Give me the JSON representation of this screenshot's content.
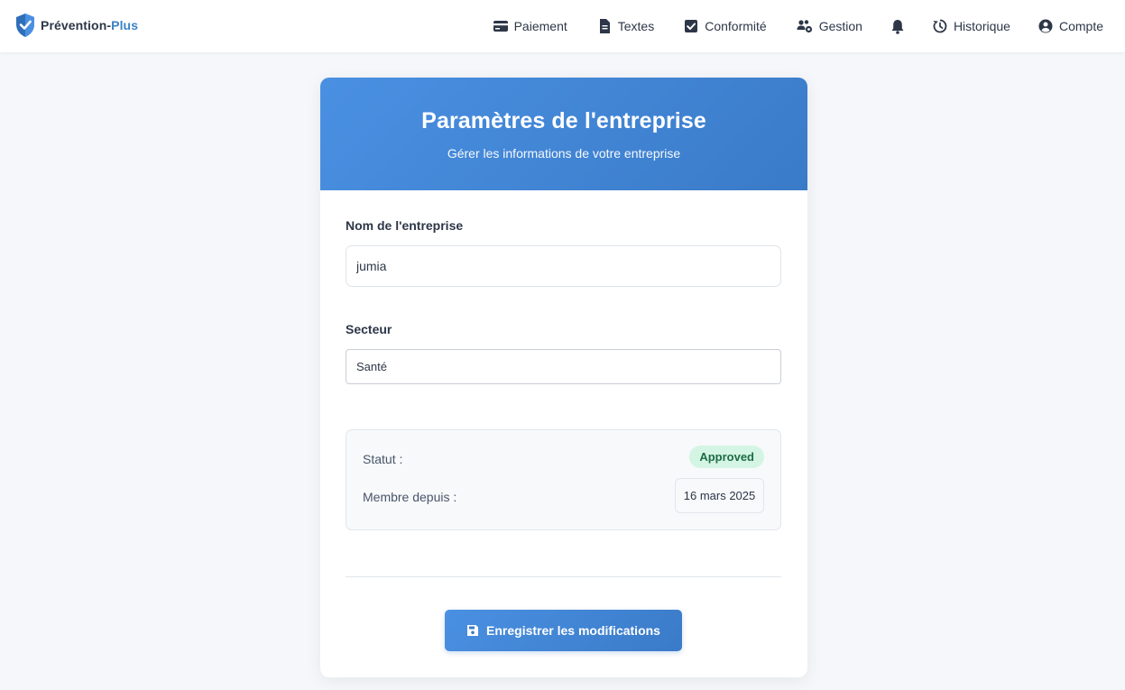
{
  "brand": {
    "name_main": "Prévention-",
    "name_accent": "Plus"
  },
  "nav": {
    "items": [
      {
        "label": "Paiement",
        "icon": "credit-card-icon"
      },
      {
        "label": "Textes",
        "icon": "document-icon"
      },
      {
        "label": "Conformité",
        "icon": "checkbox-icon"
      },
      {
        "label": "Gestion",
        "icon": "users-gear-icon"
      },
      {
        "label": "",
        "icon": "bell-icon"
      },
      {
        "label": "Historique",
        "icon": "history-icon"
      },
      {
        "label": "Compte",
        "icon": "user-circle-icon"
      }
    ]
  },
  "card": {
    "title": "Paramètres de l'entreprise",
    "subtitle": "Gérer les informations de votre entreprise"
  },
  "form": {
    "company_name_label": "Nom de l'entreprise",
    "company_name_value": "jumia",
    "sector_label": "Secteur",
    "sector_value": "Santé"
  },
  "info": {
    "status_label": "Statut :",
    "status_value": "Approved",
    "member_since_label": "Membre depuis :",
    "member_since_value": "16 mars 2025"
  },
  "actions": {
    "save_label": "Enregistrer les modifications"
  },
  "colors": {
    "accent": "#4a90e2",
    "accent_dark": "#3a7bc8",
    "badge_bg": "#d4f5e4",
    "badge_text": "#1e6b45",
    "page_bg": "#f5f7fa"
  }
}
